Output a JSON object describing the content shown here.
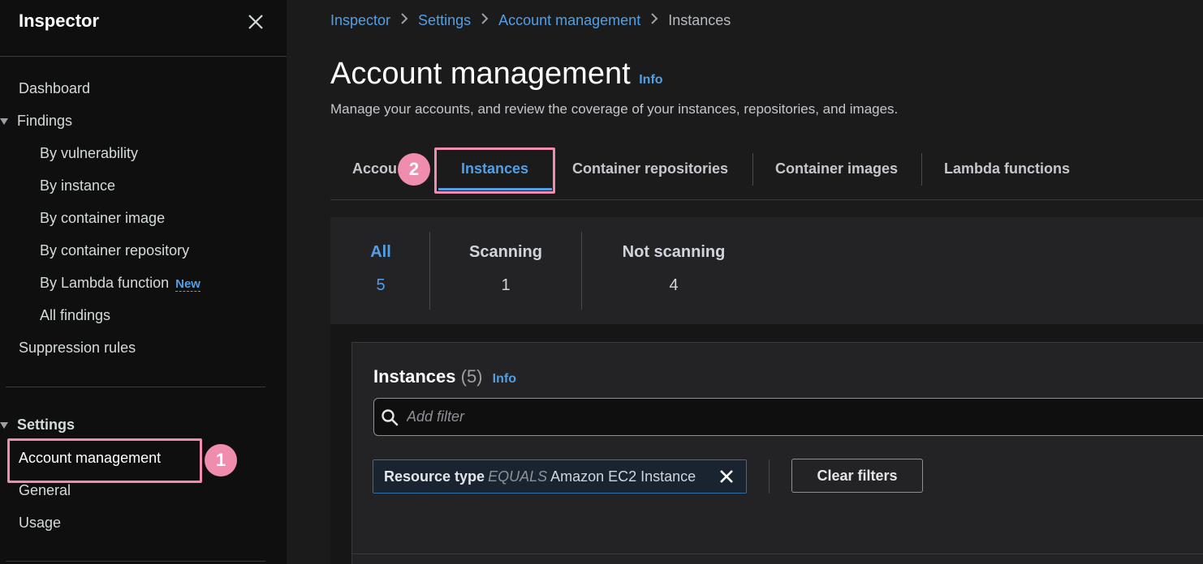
{
  "sidebar": {
    "title": "Inspector",
    "items": {
      "dashboard": "Dashboard",
      "findings": "Findings",
      "by_vulnerability": "By vulnerability",
      "by_instance": "By instance",
      "by_container_image": "By container image",
      "by_container_repository": "By container repository",
      "by_lambda_function": "By Lambda function",
      "new_badge": "New",
      "all_findings": "All findings",
      "suppression_rules": "Suppression rules",
      "settings": "Settings",
      "account_management": "Account management",
      "general": "General",
      "usage": "Usage"
    }
  },
  "annotations": {
    "step1": "1",
    "step2": "2",
    "highlight_color": "#f08cae"
  },
  "breadcrumb": {
    "items": [
      "Inspector",
      "Settings",
      "Account management"
    ],
    "current": "Instances"
  },
  "header": {
    "title": "Account management",
    "info": "Info",
    "description": "Manage your accounts, and review the coverage of your instances, repositories, and images."
  },
  "tabs": {
    "accounts": "Accou",
    "instances": "Instances",
    "container_repositories": "Container repositories",
    "container_images": "Container images",
    "lambda_functions": "Lambda functions"
  },
  "summary": {
    "all": {
      "label": "All",
      "value": "5"
    },
    "scanning": {
      "label": "Scanning",
      "value": "1"
    },
    "not_scanning": {
      "label": "Not scanning",
      "value": "4"
    }
  },
  "table": {
    "title": "Instances",
    "count": "(5)",
    "info": "Info",
    "search_placeholder": "Add filter",
    "filter": {
      "key": "Resource type",
      "operator": "EQUALS",
      "value": "Amazon EC2 Instance"
    },
    "clear_filters": "Clear filters"
  },
  "colors": {
    "accent": "#539fe5",
    "background": "#1b1b1c",
    "sidebar": "#0f0f10"
  }
}
